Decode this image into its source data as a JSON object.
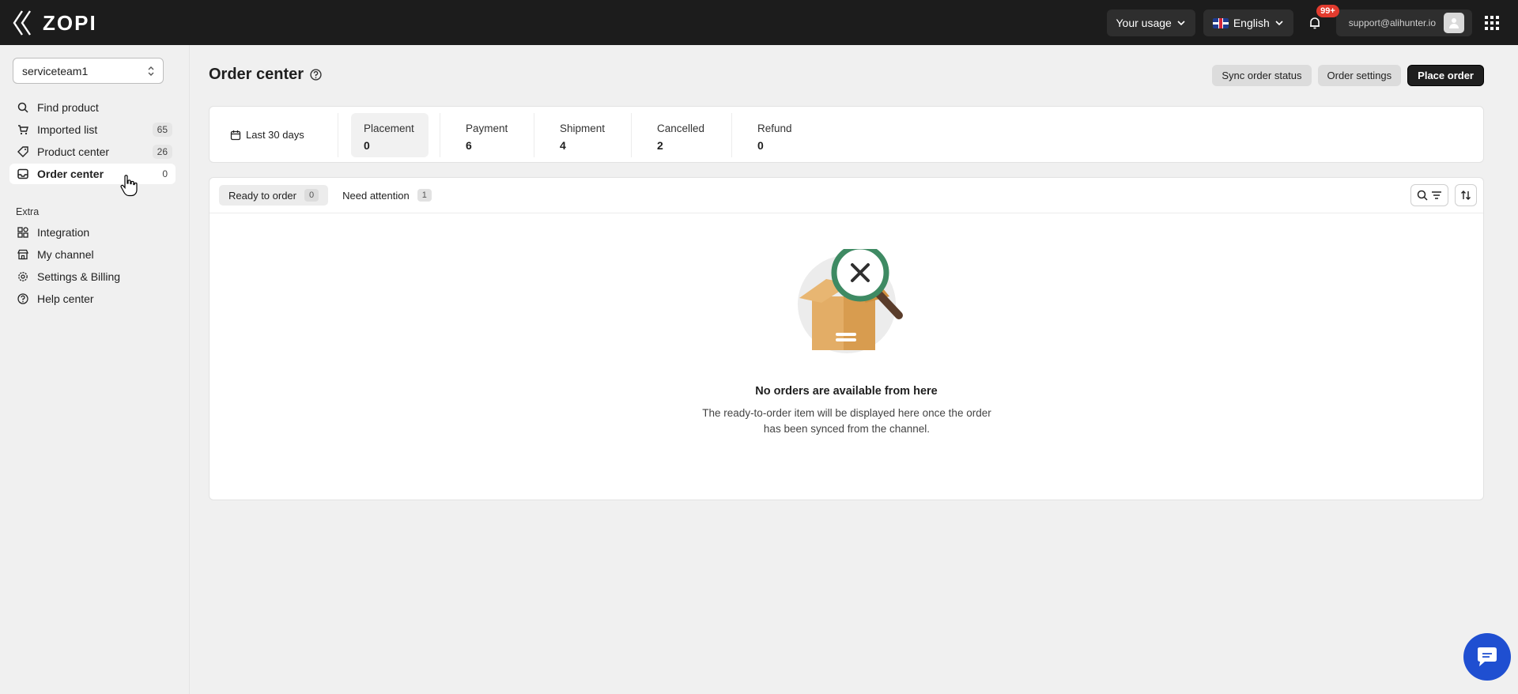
{
  "brand": {
    "name": "ZOPI"
  },
  "topbar": {
    "usage_label": "Your usage",
    "language_label": "English",
    "notifications_badge": "99+",
    "user_email": "support@alihunter.io"
  },
  "sidebar": {
    "team": "serviceteam1",
    "items": [
      {
        "label": "Find product",
        "icon": "search-icon",
        "count": ""
      },
      {
        "label": "Imported list",
        "icon": "cart-icon",
        "count": "65"
      },
      {
        "label": "Product center",
        "icon": "tag-icon",
        "count": "26"
      },
      {
        "label": "Order center",
        "icon": "inbox-icon",
        "count": "0",
        "active": true
      }
    ],
    "extra_label": "Extra",
    "extra_items": [
      {
        "label": "Integration",
        "icon": "grid-icon"
      },
      {
        "label": "My channel",
        "icon": "store-icon"
      },
      {
        "label": "Settings & Billing",
        "icon": "gear-icon"
      },
      {
        "label": "Help center",
        "icon": "help-icon"
      }
    ]
  },
  "main": {
    "title": "Order center",
    "actions": {
      "sync": "Sync order status",
      "settings": "Order settings",
      "place": "Place order"
    },
    "date_range": "Last 30 days",
    "stats": [
      {
        "label": "Placement",
        "value": "0",
        "active": true
      },
      {
        "label": "Payment",
        "value": "6"
      },
      {
        "label": "Shipment",
        "value": "4"
      },
      {
        "label": "Cancelled",
        "value": "2"
      },
      {
        "label": "Refund",
        "value": "0"
      }
    ],
    "tabs": [
      {
        "label": "Ready to order",
        "count": "0",
        "active": true
      },
      {
        "label": "Need attention",
        "count": "1"
      }
    ],
    "empty": {
      "title": "No orders are available from here",
      "desc_line1": "The ready-to-order item will be displayed here once the order",
      "desc_line2": "has been synced from the channel."
    }
  },
  "colors": {
    "topbar": "#1c1c1c",
    "accent_blue": "#1f4fd1",
    "badge_red": "#e23b2e",
    "illus_green": "#3e8a63",
    "box_orange": "#d9a255"
  }
}
